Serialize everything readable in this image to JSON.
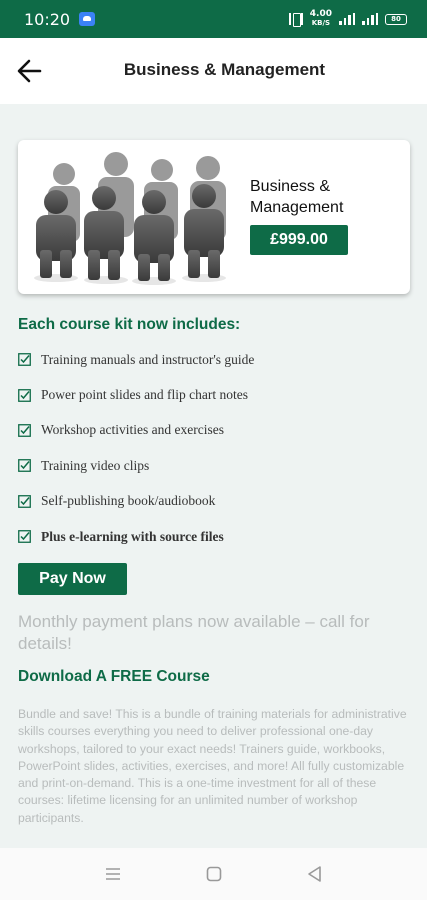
{
  "status_bar": {
    "time": "10:20",
    "net_speed_value": "4.00",
    "net_speed_unit": "KB/S",
    "battery": "80"
  },
  "header": {
    "title": "Business & Management",
    "back_icon": "arrow-left-icon"
  },
  "product": {
    "name": "Business & Management",
    "price": "£999.00",
    "image_description": "group-of-people-figures"
  },
  "kit": {
    "heading": "Each course kit now includes:",
    "items": [
      {
        "label": "Training manuals and instructor's guide",
        "bold": false
      },
      {
        "label": "Power point slides and flip chart notes",
        "bold": false
      },
      {
        "label": "Workshop activities and exercises",
        "bold": false
      },
      {
        "label": "Training video clips",
        "bold": false
      },
      {
        "label": "Self-publishing book/audiobook",
        "bold": false
      },
      {
        "label": "Plus e-learning with source files",
        "bold": true
      }
    ]
  },
  "pay_button": {
    "label": "Pay Now"
  },
  "payment_note": "Monthly payment plans now available – call for details!",
  "download": {
    "label": "Download A FREE Course"
  },
  "description": "Bundle and save! This is a bundle of training materials for administrative skills courses everything you need to deliver professional one-day workshops, tailored to your exact needs! Trainers guide, workbooks, PowerPoint slides, activities, exercises, and more! All fully customizable and print-on-demand. This is a one-time investment for all of these courses: lifetime licensing for an unlimited number of workshop participants.",
  "colors": {
    "brand": "#0e6b47",
    "background": "#eef3f2",
    "muted_text": "#b8bcbc"
  },
  "nav": {
    "menu_icon": "menu-icon",
    "home_icon": "home-square-icon",
    "back_icon": "back-triangle-icon"
  }
}
